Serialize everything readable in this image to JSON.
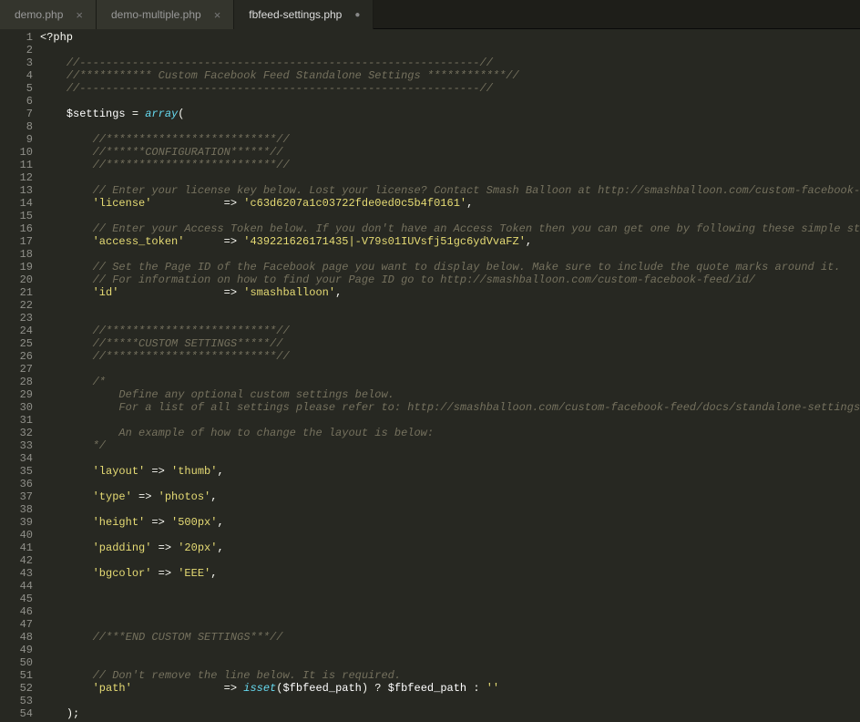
{
  "tabs": [
    {
      "label": "demo.php",
      "active": false,
      "dirty": false
    },
    {
      "label": "demo-multiple.php",
      "active": false,
      "dirty": false
    },
    {
      "label": "fbfeed-settings.php",
      "active": true,
      "dirty": true
    }
  ],
  "close_glyph": "×",
  "dirty_glyph": "●",
  "lines": [
    {
      "n": "1",
      "seg": [
        [
          "p",
          "<?php"
        ]
      ]
    },
    {
      "n": "2",
      "seg": []
    },
    {
      "n": "3",
      "seg": [
        [
          "in",
          "    "
        ],
        [
          "c",
          "//-------------------------------------------------------------//"
        ]
      ]
    },
    {
      "n": "4",
      "seg": [
        [
          "in",
          "    "
        ],
        [
          "c",
          "//*********** Custom Facebook Feed Standalone Settings ************//"
        ]
      ]
    },
    {
      "n": "5",
      "seg": [
        [
          "in",
          "    "
        ],
        [
          "c",
          "//-------------------------------------------------------------//"
        ]
      ]
    },
    {
      "n": "6",
      "seg": []
    },
    {
      "n": "7",
      "seg": [
        [
          "in",
          "    "
        ],
        [
          "var",
          "$settings"
        ],
        [
          "p",
          " = "
        ],
        [
          "f",
          "array"
        ],
        [
          "p",
          "("
        ]
      ]
    },
    {
      "n": "8",
      "seg": []
    },
    {
      "n": "9",
      "seg": [
        [
          "in",
          "        "
        ],
        [
          "c",
          "//**************************//"
        ]
      ]
    },
    {
      "n": "10",
      "seg": [
        [
          "in",
          "        "
        ],
        [
          "c",
          "//******CONFIGURATION******//"
        ]
      ]
    },
    {
      "n": "11",
      "seg": [
        [
          "in",
          "        "
        ],
        [
          "c",
          "//**************************//"
        ]
      ]
    },
    {
      "n": "12",
      "seg": []
    },
    {
      "n": "13",
      "seg": [
        [
          "in",
          "        "
        ],
        [
          "c",
          "// Enter your license key below. Lost your license? Contact Smash Balloon at http://smashballoon.com/custom-facebook-feed/su"
        ]
      ]
    },
    {
      "n": "14",
      "seg": [
        [
          "in",
          "        "
        ],
        [
          "s",
          "'license'"
        ],
        [
          "p",
          "           => "
        ],
        [
          "s",
          "'c63d6207a1c03722fde0ed0c5b4f0161'"
        ],
        [
          "p",
          ","
        ]
      ]
    },
    {
      "n": "15",
      "seg": []
    },
    {
      "n": "16",
      "seg": [
        [
          "in",
          "        "
        ],
        [
          "c",
          "// Enter your Access Token below. If you don't have an Access Token then you can get one by following these simple steps: ht"
        ]
      ]
    },
    {
      "n": "17",
      "seg": [
        [
          "in",
          "        "
        ],
        [
          "s",
          "'access_token'"
        ],
        [
          "p",
          "      => "
        ],
        [
          "s",
          "'439221626171435|-V79s01IUVsfj51gc6ydVvaFZ'"
        ],
        [
          "p",
          ","
        ]
      ]
    },
    {
      "n": "18",
      "seg": []
    },
    {
      "n": "19",
      "seg": [
        [
          "in",
          "        "
        ],
        [
          "c",
          "// Set the Page ID of the Facebook page you want to display below. Make sure to include the quote marks around it."
        ]
      ]
    },
    {
      "n": "20",
      "seg": [
        [
          "in",
          "        "
        ],
        [
          "c",
          "// For information on how to find your Page ID go to http://smashballoon.com/custom-facebook-feed/id/"
        ]
      ]
    },
    {
      "n": "21",
      "seg": [
        [
          "in",
          "        "
        ],
        [
          "s",
          "'id'"
        ],
        [
          "p",
          "                => "
        ],
        [
          "s",
          "'smashballoon'"
        ],
        [
          "p",
          ","
        ]
      ]
    },
    {
      "n": "22",
      "seg": []
    },
    {
      "n": "23",
      "seg": []
    },
    {
      "n": "24",
      "seg": [
        [
          "in",
          "        "
        ],
        [
          "c",
          "//**************************//"
        ]
      ]
    },
    {
      "n": "25",
      "seg": [
        [
          "in",
          "        "
        ],
        [
          "c",
          "//*****CUSTOM SETTINGS*****//"
        ]
      ]
    },
    {
      "n": "26",
      "seg": [
        [
          "in",
          "        "
        ],
        [
          "c",
          "//**************************//"
        ]
      ]
    },
    {
      "n": "27",
      "seg": []
    },
    {
      "n": "28",
      "seg": [
        [
          "in",
          "        "
        ],
        [
          "c",
          "/*"
        ]
      ]
    },
    {
      "n": "29",
      "seg": [
        [
          "in",
          "        "
        ],
        [
          "c",
          "    Define any optional custom settings below."
        ]
      ]
    },
    {
      "n": "30",
      "seg": [
        [
          "in",
          "        "
        ],
        [
          "c",
          "    For a list of all settings please refer to: http://smashballoon.com/custom-facebook-feed/docs/standalone-settings/"
        ]
      ]
    },
    {
      "n": "31",
      "seg": []
    },
    {
      "n": "32",
      "seg": [
        [
          "in",
          "        "
        ],
        [
          "c",
          "    An example of how to change the layout is below:"
        ]
      ]
    },
    {
      "n": "33",
      "seg": [
        [
          "in",
          "        "
        ],
        [
          "c",
          "*/"
        ]
      ]
    },
    {
      "n": "34",
      "seg": []
    },
    {
      "n": "35",
      "seg": [
        [
          "in",
          "        "
        ],
        [
          "s",
          "'layout'"
        ],
        [
          "p",
          " => "
        ],
        [
          "s",
          "'thumb'"
        ],
        [
          "p",
          ","
        ]
      ]
    },
    {
      "n": "36",
      "seg": []
    },
    {
      "n": "37",
      "seg": [
        [
          "in",
          "        "
        ],
        [
          "s",
          "'type'"
        ],
        [
          "p",
          " => "
        ],
        [
          "s",
          "'photos'"
        ],
        [
          "p",
          ","
        ]
      ]
    },
    {
      "n": "38",
      "seg": []
    },
    {
      "n": "39",
      "seg": [
        [
          "in",
          "        "
        ],
        [
          "s",
          "'height'"
        ],
        [
          "p",
          " => "
        ],
        [
          "s",
          "'500px'"
        ],
        [
          "p",
          ","
        ]
      ]
    },
    {
      "n": "40",
      "seg": []
    },
    {
      "n": "41",
      "seg": [
        [
          "in",
          "        "
        ],
        [
          "s",
          "'padding'"
        ],
        [
          "p",
          " => "
        ],
        [
          "s",
          "'20px'"
        ],
        [
          "p",
          ","
        ]
      ]
    },
    {
      "n": "42",
      "seg": []
    },
    {
      "n": "43",
      "seg": [
        [
          "in",
          "        "
        ],
        [
          "s",
          "'bgcolor'"
        ],
        [
          "p",
          " => "
        ],
        [
          "s",
          "'EEE'"
        ],
        [
          "p",
          ","
        ]
      ]
    },
    {
      "n": "44",
      "seg": []
    },
    {
      "n": "45",
      "seg": []
    },
    {
      "n": "46",
      "seg": []
    },
    {
      "n": "47",
      "seg": []
    },
    {
      "n": "48",
      "seg": [
        [
          "in",
          "        "
        ],
        [
          "c",
          "//***END CUSTOM SETTINGS***//"
        ]
      ]
    },
    {
      "n": "49",
      "seg": []
    },
    {
      "n": "50",
      "seg": []
    },
    {
      "n": "51",
      "seg": [
        [
          "in",
          "        "
        ],
        [
          "c",
          "// Don't remove the line below. It is required."
        ]
      ]
    },
    {
      "n": "52",
      "seg": [
        [
          "in",
          "        "
        ],
        [
          "s",
          "'path'"
        ],
        [
          "p",
          "              => "
        ],
        [
          "f",
          "isset"
        ],
        [
          "p",
          "("
        ],
        [
          "var",
          "$fbfeed_path"
        ],
        [
          "p",
          ") ? "
        ],
        [
          "var",
          "$fbfeed_path"
        ],
        [
          "p",
          " : "
        ],
        [
          "s",
          "''"
        ]
      ]
    },
    {
      "n": "53",
      "seg": []
    },
    {
      "n": "54",
      "seg": [
        [
          "in",
          "    "
        ],
        [
          "p",
          ");"
        ]
      ]
    }
  ]
}
